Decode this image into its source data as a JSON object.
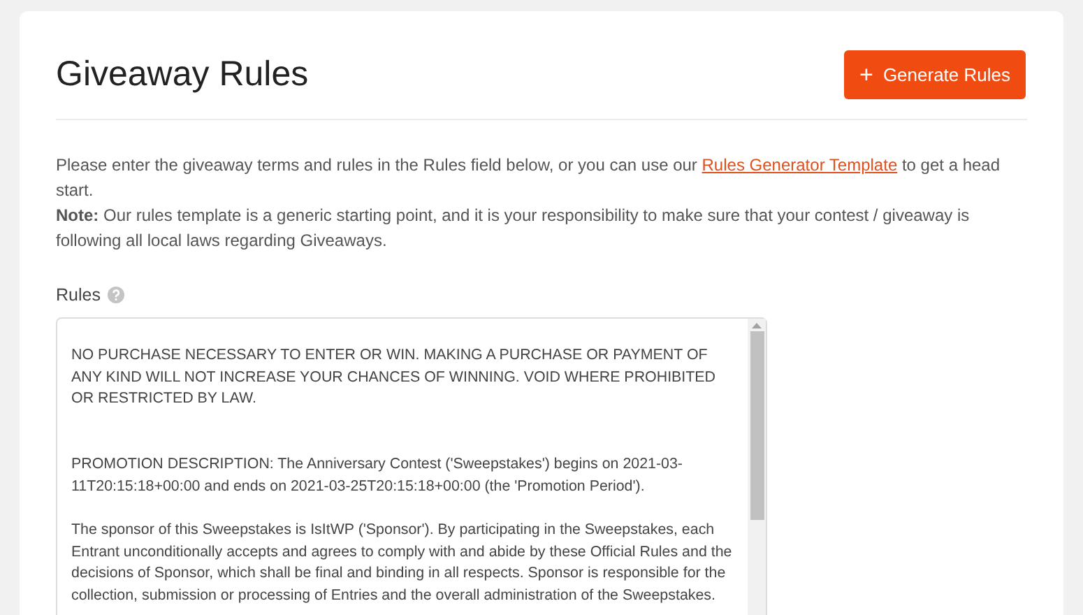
{
  "header": {
    "title": "Giveaway Rules",
    "button": {
      "icon": "+",
      "label": "Generate Rules"
    }
  },
  "intro": {
    "before_link": "Please enter the giveaway terms and rules in the Rules field below, or you can use our",
    "link": "Rules Generator Template",
    "after_link": "to get a head start.",
    "note": "**Note:** Our rules template is a generic starting point, and it is your responsibility to make sure that your contest / giveaway is following all local laws regarding Giveaways."
  },
  "rules_field": {
    "label": "Rules",
    "paragraphs": [
      "NO PURCHASE NECESSARY TO ENTER OR WIN. MAKING A PURCHASE OR PAYMENT OF ANY KIND WILL NOT INCREASE YOUR CHANCES OF WINNING. VOID WHERE PROHIBITED OR RESTRICTED BY LAW.",
      "PROMOTION DESCRIPTION: The Anniversary Contest ('Sweepstakes') begins on 2021-03-11T20:15:18+00:00 and ends on 2021-03-25T20:15:18+00:00 (the 'Promotion Period').",
      "The sponsor of this Sweepstakes is IsItWP ('Sponsor'). By participating in the Sweepstakes, each Entrant unconditionally accepts and agrees to comply with and abide by these Official Rules and the decisions of Sponsor, which shall be final and binding in all respects. Sponsor is responsible for the collection, submission or processing of Entries and the overall administration of the Sweepstakes."
    ]
  }
}
